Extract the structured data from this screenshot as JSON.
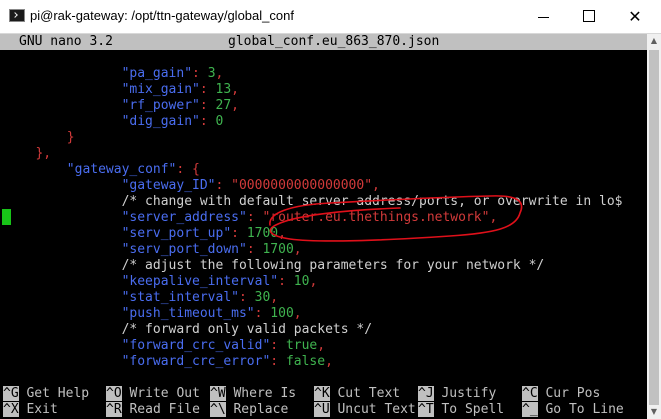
{
  "window": {
    "title": "pi@rak-gateway: /opt/ttn-gateway/global_conf",
    "minimize_glyph": "—",
    "close_glyph": "✕"
  },
  "nano": {
    "version": "GNU nano 3.2",
    "filename": "global_conf.eu_863_870.json"
  },
  "lines": [
    {
      "indent": "              ",
      "key": "\"pa_gain\"",
      "sep": ": ",
      "val": "3",
      "valtype": "n",
      "tail": ","
    },
    {
      "indent": "              ",
      "key": "\"mix_gain\"",
      "sep": ": ",
      "val": "13",
      "valtype": "n",
      "tail": ","
    },
    {
      "indent": "              ",
      "key": "\"rf_power\"",
      "sep": ": ",
      "val": "27",
      "valtype": "n",
      "tail": ","
    },
    {
      "indent": "              ",
      "key": "\"dig_gain\"",
      "sep": ": ",
      "val": "0",
      "valtype": "n",
      "tail": ""
    },
    {
      "indent": "       ",
      "brace": "}"
    },
    {
      "indent": "   ",
      "brace": "},"
    },
    {
      "indent": "       ",
      "key": "\"gateway_conf\"",
      "sep": ": ",
      "brace2": "{"
    },
    {
      "indent": "              ",
      "key": "\"gateway_ID\"",
      "sep": ": ",
      "val": "\"0000000000000000\"",
      "valtype": "s",
      "tail": ","
    },
    {
      "indent": "              ",
      "comment": "/* change with default server address/ports, or overwrite in lo$"
    },
    {
      "indent": "              ",
      "key": "\"server_address\"",
      "sep": ": ",
      "val": "\"router.eu.thethings.network\"",
      "valtype": "s",
      "tail": ","
    },
    {
      "indent": "              ",
      "key": "\"serv_port_up\"",
      "sep": ": ",
      "val": "1700",
      "valtype": "n",
      "tail": ","
    },
    {
      "indent": "              ",
      "key": "\"serv_port_down\"",
      "sep": ": ",
      "val": "1700",
      "valtype": "n",
      "tail": ","
    },
    {
      "indent": "              ",
      "comment": "/* adjust the following parameters for your network */"
    },
    {
      "indent": "              ",
      "key": "\"keepalive_interval\"",
      "sep": ": ",
      "val": "10",
      "valtype": "n",
      "tail": ","
    },
    {
      "indent": "              ",
      "key": "\"stat_interval\"",
      "sep": ": ",
      "val": "30",
      "valtype": "n",
      "tail": ","
    },
    {
      "indent": "              ",
      "key": "\"push_timeout_ms\"",
      "sep": ": ",
      "val": "100",
      "valtype": "n",
      "tail": ","
    },
    {
      "indent": "              ",
      "comment": "/* forward only valid packets */"
    },
    {
      "indent": "              ",
      "key": "\"forward_crc_valid\"",
      "sep": ": ",
      "val": "true",
      "valtype": "n",
      "tail": ","
    },
    {
      "indent": "              ",
      "key": "\"forward_crc_error\"",
      "sep": ": ",
      "val": "false",
      "valtype": "n",
      "tail": ","
    }
  ],
  "shortcuts": [
    {
      "key": "^G",
      "label": "Get Help"
    },
    {
      "key": "^O",
      "label": "Write Out"
    },
    {
      "key": "^W",
      "label": "Where Is"
    },
    {
      "key": "^K",
      "label": "Cut Text"
    },
    {
      "key": "^J",
      "label": "Justify"
    },
    {
      "key": "^C",
      "label": "Cur Pos"
    },
    {
      "key": "^X",
      "label": "Exit"
    },
    {
      "key": "^R",
      "label": "Read File"
    },
    {
      "key": "^\\",
      "label": "Replace"
    },
    {
      "key": "^U",
      "label": "Uncut Text"
    },
    {
      "key": "^T",
      "label": "To Spell"
    },
    {
      "key": "^_",
      "label": "Go To Line"
    }
  ],
  "colors": {
    "key_blue": "#4a6df0",
    "string_red": "#d23a3a",
    "number_green": "#3fb34f",
    "annotation_red": "#e0101a"
  },
  "icons": {
    "app": "terminal-icon",
    "minimize": "minimize-icon",
    "maximize": "maximize-icon",
    "close": "close-icon"
  }
}
